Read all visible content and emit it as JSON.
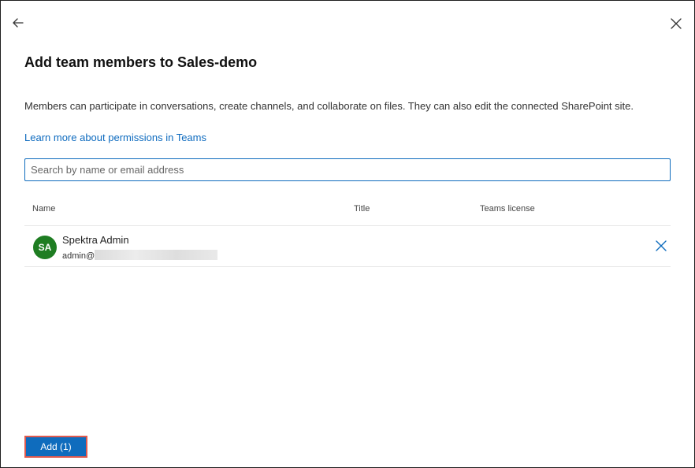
{
  "dialog": {
    "title": "Add team members to Sales-demo",
    "description": "Members can participate in conversations, create channels, and collaborate on files. They can also edit the connected SharePoint site.",
    "learn_more_link": "Learn more about permissions in Teams"
  },
  "search": {
    "placeholder": "Search by name or email address",
    "value": ""
  },
  "table": {
    "columns": [
      "Name",
      "Title",
      "Teams license"
    ],
    "rows": [
      {
        "initials": "SA",
        "name": "Spektra Admin",
        "email_prefix": "admin@",
        "title": "",
        "license": ""
      }
    ]
  },
  "footer": {
    "add_label": "Add (1)"
  },
  "icons": {
    "back": "arrow-left-icon",
    "close": "close-icon",
    "remove": "close-icon"
  },
  "colors": {
    "accent": "#0f6cbd",
    "avatar": "#1e7d22",
    "highlight_border": "#e05a4e"
  }
}
